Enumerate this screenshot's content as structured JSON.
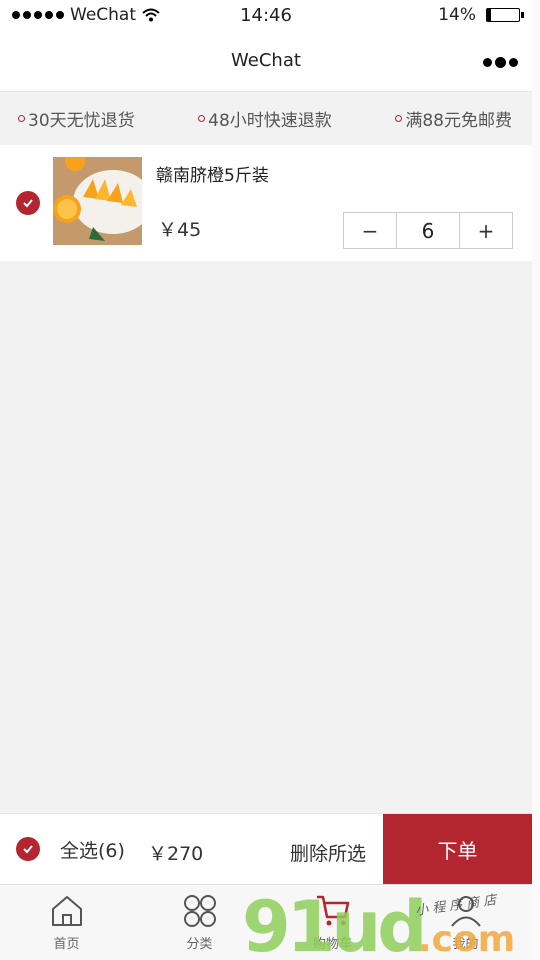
{
  "status_bar": {
    "carrier": "WeChat",
    "time": "14:46",
    "battery_percent": "14%",
    "battery_level": 0.14
  },
  "nav": {
    "title": "WeChat"
  },
  "promos": [
    {
      "text": "30天无忧退货"
    },
    {
      "text": "48小时快速退款"
    },
    {
      "text": "满88元免邮费"
    }
  ],
  "cart": {
    "items": [
      {
        "name": "赣南脐橙5斤装",
        "price": "￥45",
        "quantity": "6",
        "selected": true,
        "minus_symbol": "−",
        "plus_symbol": "+"
      }
    ]
  },
  "checkout": {
    "select_all_label": "全选(6)",
    "total": "￥270",
    "delete_label": "删除所选",
    "order_label": "下单"
  },
  "tabs": [
    {
      "label": "首页",
      "icon": "home-icon"
    },
    {
      "label": "分类",
      "icon": "category-icon"
    },
    {
      "label": "购物车",
      "icon": "cart-icon",
      "active": true
    },
    {
      "label": "我的",
      "icon": "profile-icon"
    }
  ],
  "watermark": {
    "text": "91ud.com",
    "subtext": "小程序商店"
  },
  "colors": {
    "accent": "#b32630",
    "watermark_green": "#8fcf5a",
    "watermark_orange": "#f2a93b"
  }
}
